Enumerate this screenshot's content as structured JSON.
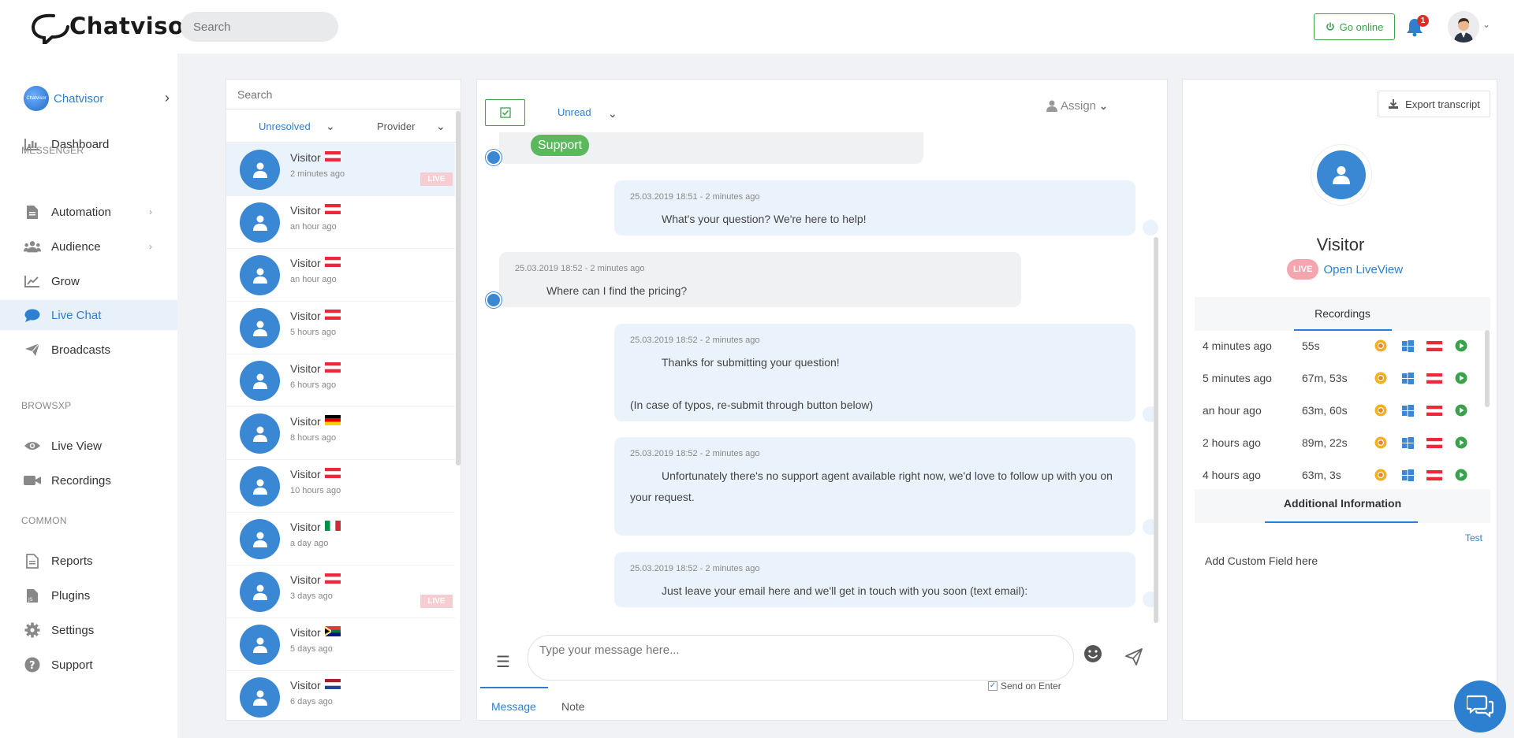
{
  "header": {
    "logo_text": "Chatvisor",
    "search_placeholder": "Search",
    "go_online_label": "Go online",
    "notification_count": "1",
    "colors": {
      "primary": "#2d7fd0",
      "success": "#3aa24a",
      "danger": "#e02b2b"
    }
  },
  "sidebar": {
    "workspace_name": "Chatvisor",
    "workspace_logo_text": "Chatvisor",
    "items": [
      {
        "label": "Dashboard",
        "icon": "chart-bar-icon"
      },
      {
        "label": "Automation",
        "icon": "document-icon",
        "has_submenu": true
      },
      {
        "label": "Audience",
        "icon": "users-icon",
        "has_submenu": true
      },
      {
        "label": "Grow",
        "icon": "line-chart-icon"
      },
      {
        "label": "Live Chat",
        "icon": "chat-bubble-icon",
        "active": true
      },
      {
        "label": "Broadcasts",
        "icon": "paper-plane-icon"
      },
      {
        "label": "Live View",
        "icon": "eye-icon"
      },
      {
        "label": "Recordings",
        "icon": "video-camera-icon"
      },
      {
        "label": "Reports",
        "icon": "report-icon"
      },
      {
        "label": "Plugins",
        "icon": "js-file-icon"
      },
      {
        "label": "Settings",
        "icon": "gear-icon"
      },
      {
        "label": "Support",
        "icon": "question-circle-icon"
      }
    ],
    "sections": {
      "messenger": "MESSENGER",
      "browsxp": "BROWSXP",
      "common": "COMMON"
    }
  },
  "visitor_list": {
    "search_placeholder": "Search",
    "filter_status": "Unresolved",
    "filter_provider": "Provider",
    "live_label": "LIVE",
    "visitors": [
      {
        "name": "Visitor",
        "flag": "austria",
        "time": "2 minutes ago",
        "live": true,
        "selected": true
      },
      {
        "name": "Visitor",
        "flag": "austria",
        "time": "an hour ago",
        "live": false
      },
      {
        "name": "Visitor",
        "flag": "austria",
        "time": "an hour ago",
        "live": false
      },
      {
        "name": "Visitor",
        "flag": "austria",
        "time": "5 hours ago",
        "live": false
      },
      {
        "name": "Visitor",
        "flag": "austria",
        "time": "6 hours ago",
        "live": false
      },
      {
        "name": "Visitor",
        "flag": "germany",
        "time": "8 hours ago",
        "live": false
      },
      {
        "name": "Visitor",
        "flag": "austria",
        "time": "10 hours ago",
        "live": false
      },
      {
        "name": "Visitor",
        "flag": "italy",
        "time": "a day ago",
        "live": false
      },
      {
        "name": "Visitor",
        "flag": "austria",
        "time": "3 days ago",
        "live": true
      },
      {
        "name": "Visitor",
        "flag": "south-africa",
        "time": "5 days ago",
        "live": false
      },
      {
        "name": "Visitor",
        "flag": "netherlands",
        "time": "6 days ago",
        "live": false
      }
    ]
  },
  "chat": {
    "filter_label": "Unread",
    "assign_label": "Assign",
    "support_chip": "Support",
    "messages": [
      {
        "direction": "out",
        "meta": "25.03.2019 18:51 - 2 minutes ago",
        "text": "What's your question? We're here to help!"
      },
      {
        "direction": "in",
        "meta": "25.03.2019 18:52 - 2 minutes ago",
        "text": "Where can I find the pricing?"
      },
      {
        "direction": "out",
        "meta": "25.03.2019 18:52 - 2 minutes ago",
        "text": "Thanks for submitting your question!\n\n(In case of typos, re-submit through button below)"
      },
      {
        "direction": "out",
        "meta": "25.03.2019 18:52 - 2 minutes ago",
        "text": "Unfortunately there's no support agent available right now, we'd love to follow up with you on your request."
      },
      {
        "direction": "out",
        "meta": "25.03.2019 18:52 - 2 minutes ago",
        "text": "Just leave your email here and we'll get in touch with you soon (text email):"
      }
    ],
    "composer_placeholder": "Type your message here...",
    "send_on_enter_label": "Send on Enter",
    "send_on_enter_checked": true,
    "tab_message": "Message",
    "tab_note": "Note"
  },
  "info": {
    "export_label": "Export transcript",
    "visitor_title": "Visitor",
    "live_pill": "LIVE",
    "open_liveview": "Open LiveView",
    "recordings_title": "Recordings",
    "recordings": [
      {
        "when": "4 minutes ago",
        "duration": "55s"
      },
      {
        "when": "5 minutes ago",
        "duration": "67m, 53s"
      },
      {
        "when": "an hour ago",
        "duration": "63m, 60s"
      },
      {
        "when": "2 hours ago",
        "duration": "89m, 22s"
      },
      {
        "when": "4 hours ago",
        "duration": "63m, 3s"
      }
    ],
    "additional_title": "Additional Information",
    "test_link": "Test",
    "custom_field": "Add Custom Field here"
  }
}
